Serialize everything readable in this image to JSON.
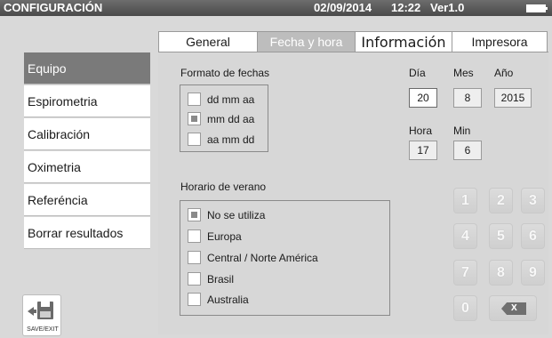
{
  "titlebar": {
    "title": "CONFIGURACIÓN",
    "date": "02/09/2014",
    "time": "12:22",
    "version": "Ver1.0",
    "battery_icon": "battery-icon"
  },
  "tabs": [
    {
      "label": "General",
      "active": false
    },
    {
      "label": "Fecha y hora",
      "active": true
    },
    {
      "label": "Información",
      "active": false
    },
    {
      "label": "Impresora",
      "active": false
    }
  ],
  "sidebar": {
    "items": [
      {
        "label": "Equipo",
        "active": true
      },
      {
        "label": "Espirometria",
        "active": false
      },
      {
        "label": "Calibración",
        "active": false
      },
      {
        "label": "Oximetria",
        "active": false
      },
      {
        "label": "Referéncia",
        "active": false
      },
      {
        "label": "Borrar resultados",
        "active": false
      }
    ],
    "save_label": "SAVE/EXIT"
  },
  "date_format": {
    "label": "Formato de fechas",
    "options": [
      {
        "label": "dd mm aa",
        "checked": false
      },
      {
        "label": "mm dd aa",
        "checked": true
      },
      {
        "label": "aa mm dd",
        "checked": false
      }
    ]
  },
  "dst": {
    "label": "Horario de verano",
    "options": [
      {
        "label": "No se utiliza",
        "checked": true
      },
      {
        "label": "Europa",
        "checked": false
      },
      {
        "label": "Central / Norte América",
        "checked": false
      },
      {
        "label": "Brasil",
        "checked": false
      },
      {
        "label": "Australia",
        "checked": false
      }
    ]
  },
  "datetime": {
    "day_label": "Día",
    "day": "20",
    "month_label": "Mes",
    "month": "8",
    "year_label": "Año",
    "year": "2015",
    "hour_label": "Hora",
    "hour": "17",
    "min_label": "Min",
    "min": "6"
  },
  "keypad": {
    "keys": [
      "1",
      "2",
      "3",
      "4",
      "5",
      "6",
      "7",
      "8",
      "9",
      "0"
    ],
    "backspace_label": "X"
  },
  "colors": {
    "titlebar": "#4a4a4a",
    "panel": "#d7d7d7",
    "active_tab": "#bdbdbd",
    "active_sidebar": "#7a7a7a"
  }
}
